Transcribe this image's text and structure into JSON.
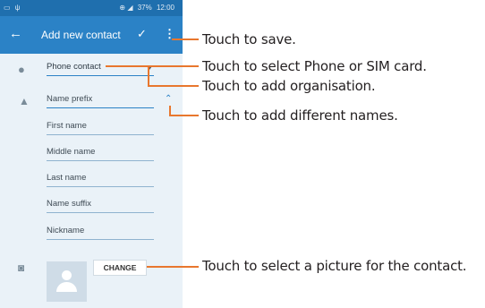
{
  "status_bar": {
    "left_icons": [
      "gallery-icon",
      "usb-icon"
    ],
    "signal": "⊕ ◢",
    "battery": "37%",
    "time": "12:00"
  },
  "app_bar": {
    "title": "Add new contact",
    "back_icon": "back-arrow-icon",
    "save_icon": "check-icon",
    "more_icon": "more-vert-icon"
  },
  "form": {
    "account": "Phone contact",
    "fields": [
      {
        "label": "Name prefix"
      },
      {
        "label": "First name"
      },
      {
        "label": "Middle name"
      },
      {
        "label": "Last name"
      },
      {
        "label": "Name suffix"
      },
      {
        "label": "Nickname"
      }
    ],
    "change_button": "CHANGE"
  },
  "callouts": {
    "save": "Touch to save.",
    "account": "Touch to select Phone or SIM card.",
    "organisation": "Touch to add organisation.",
    "names": "Touch to add different names.",
    "picture": "Touch to select a picture for the contact."
  },
  "colors": {
    "accent": "#2b82c6",
    "status_bar": "#1f6fae",
    "callout_line": "#e8772e",
    "screen_bg": "#eaf2f8"
  }
}
